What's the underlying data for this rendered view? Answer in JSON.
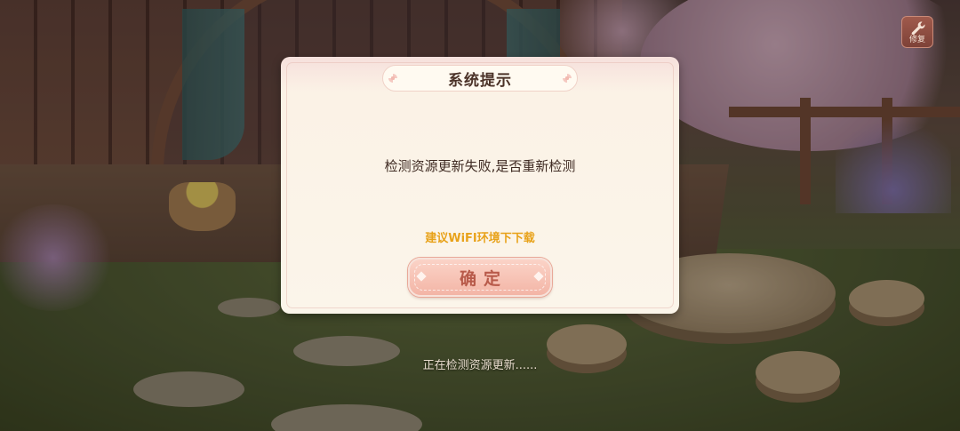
{
  "dialog": {
    "title": "系统提示",
    "message": "检测资源更新失败,是否重新检测",
    "hint": "建议WiFI环境下下载",
    "confirm_label": "确定"
  },
  "toolbar": {
    "repair_label": "修复",
    "repair_icon": "wrench-icon"
  },
  "status": {
    "text": "正在检测资源更新......"
  },
  "colors": {
    "dialog_bg": "#fbf5ea",
    "title_text": "#4b3228",
    "hint_text": "#e8a21a",
    "confirm_text": "#b85a4a",
    "confirm_bg": "#f3b5a6"
  }
}
